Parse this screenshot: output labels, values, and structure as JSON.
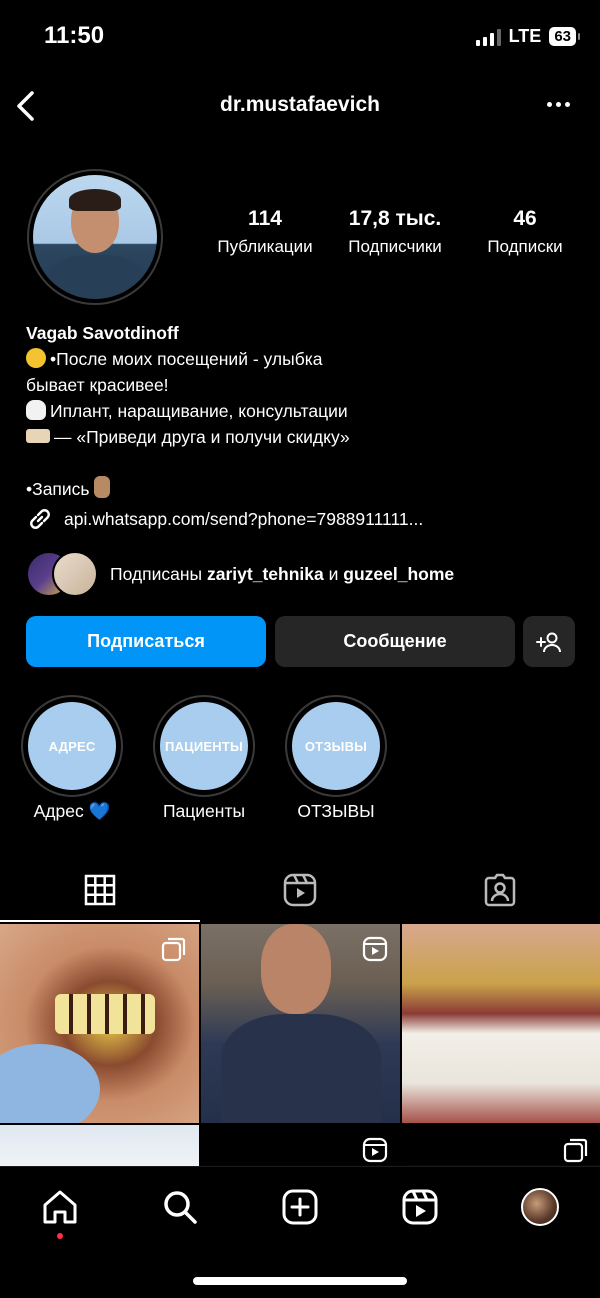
{
  "status_bar": {
    "time": "11:50",
    "network": "LTE",
    "battery": "63"
  },
  "header": {
    "username": "dr.mustafaevich"
  },
  "profile": {
    "stats": [
      {
        "value": "114",
        "label": "Публикации"
      },
      {
        "value": "17,8 тыс.",
        "label": "Подписчики"
      },
      {
        "value": "46",
        "label": "Подписки"
      }
    ],
    "name": "Vagab Savotdinoff",
    "bio": {
      "line1": "•После моих посещений - улыбка",
      "line2": "бывает красивее!",
      "line3": "Иплант, наращивание, консультации",
      "line4": "— «Приведи друга и получи скидку»",
      "line5": "•Запись"
    },
    "link": "api.whatsapp.com/send?phone=7988911111...",
    "followed_by": {
      "prefix": "Подписаны",
      "user1": "zariyt_tehnika",
      "joiner": "и",
      "user2": "guzeel_home"
    }
  },
  "actions": {
    "follow": "Подписаться",
    "message": "Сообщение"
  },
  "highlights": [
    {
      "cover_text": "АДРЕС",
      "label": "Адрес 💙"
    },
    {
      "cover_text": "ПАЦИЕНТЫ",
      "label": "Пациенты"
    },
    {
      "cover_text": "ОТЗЫВЫ",
      "label": "ОТЗЫВЫ"
    }
  ],
  "tabs": [
    {
      "icon": "grid-icon",
      "active": true
    },
    {
      "icon": "reels-icon",
      "active": false
    },
    {
      "icon": "tagged-icon",
      "active": false
    }
  ],
  "posts": [
    {
      "type": "carousel"
    },
    {
      "type": "reel"
    },
    {
      "type": "photo"
    },
    {
      "type": "photo"
    },
    {
      "type": "reel"
    },
    {
      "type": "carousel"
    }
  ],
  "nav": {
    "items": [
      "home-icon",
      "search-icon",
      "create-icon",
      "reels-icon",
      "profile-avatar"
    ],
    "active": "home-icon"
  },
  "colors": {
    "primary_button": "#0095f6",
    "secondary_button": "#262626",
    "highlight_cover": "#a8cdee",
    "notification_dot": "#ff3040"
  }
}
